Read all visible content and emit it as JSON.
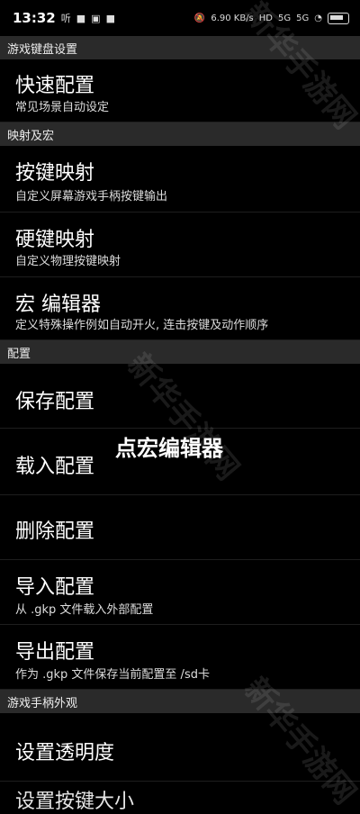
{
  "status_bar": {
    "time": "13:32",
    "left_icons": [
      "听",
      "video-icon",
      "message-icon",
      "app-icon"
    ],
    "right_icons": [
      "mute-icon",
      "6.90 KB/s",
      "HD",
      "5G",
      "5G",
      "wifi-icon",
      "battery-icon"
    ]
  },
  "sections": [
    {
      "header": "游戏键盘设置",
      "items": [
        {
          "title": "快速配置",
          "subtitle": "常见场景自动设定"
        }
      ]
    },
    {
      "header": "映射及宏",
      "items": [
        {
          "title": "按键映射",
          "subtitle": "自定义屏幕游戏手柄按键输出"
        },
        {
          "title": "硬键映射",
          "subtitle": "自定义物理按键映射"
        },
        {
          "title": "宏 编辑器",
          "subtitle": "定义特殊操作例如自动开火, 连击按键及动作顺序"
        }
      ]
    },
    {
      "header": "配置",
      "items": [
        {
          "title": "保存配置",
          "subtitle": ""
        },
        {
          "title": "载入配置",
          "subtitle": ""
        },
        {
          "title": "删除配置",
          "subtitle": ""
        },
        {
          "title": "导入配置",
          "subtitle": "从 .gkp 文件载入外部配置"
        },
        {
          "title": "导出配置",
          "subtitle": "作为 .gkp 文件保存当前配置至 /sd卡"
        }
      ]
    },
    {
      "header": "游戏手柄外观",
      "items": [
        {
          "title": "设置透明度",
          "subtitle": ""
        },
        {
          "title": "设置按键大小",
          "subtitle": ""
        }
      ]
    }
  ],
  "overlay_caption": "点宏编辑器",
  "watermark": "新华手游网"
}
